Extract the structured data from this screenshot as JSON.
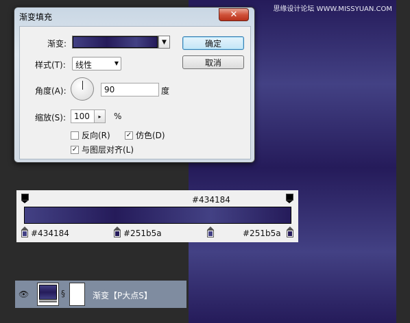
{
  "dialog": {
    "title": "渐变填充",
    "close_glyph": "✕",
    "gradient_label": "渐变:",
    "style_label": "样式(T):",
    "style_value": "线性",
    "angle_label": "角度(A):",
    "angle_value": "90",
    "angle_unit": "度",
    "scale_label": "缩放(S):",
    "scale_value": "100",
    "scale_unit": "%",
    "reverse_label": "反向(R)",
    "reverse_checked": false,
    "dither_label": "仿色(D)",
    "dither_checked": true,
    "align_label": "与图层对齐(L)",
    "align_checked": true,
    "ok_label": "确定",
    "cancel_label": "取消",
    "check_mark": "✓"
  },
  "gradient_editor": {
    "top_stop_color_label": "#434184",
    "stops": [
      {
        "label": "#434184",
        "color": "#434184"
      },
      {
        "label": "#251b5a",
        "color": "#251b5a"
      },
      {
        "label": "#251b5a",
        "color": "#251b5a"
      }
    ],
    "colors": {
      "light": "#434184",
      "dark": "#251b5a"
    }
  },
  "layer": {
    "name": "渐变【P大点S】",
    "eye_icon": "eye-icon",
    "link_glyph": "§"
  },
  "watermark": "思缘设计论坛 WWW.MISSYUAN.COM"
}
